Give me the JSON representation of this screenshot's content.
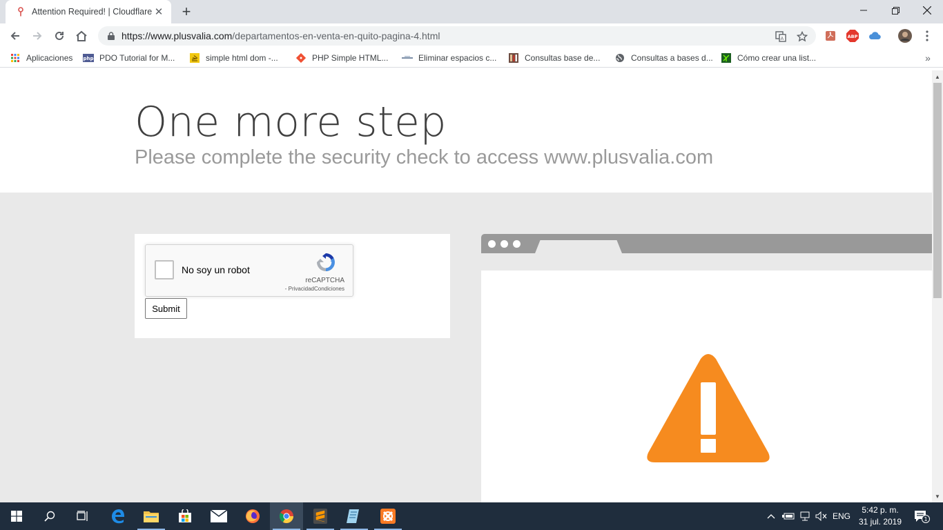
{
  "browser": {
    "tab_title": "Attention Required! | Cloudflare",
    "url_host": "https://www.plusvalia.com",
    "url_path": "/departamentos-en-venta-en-quito-pagina-4.html"
  },
  "bookmarks": [
    {
      "label": "Aplicaciones",
      "icon": "apps-grid-icon"
    },
    {
      "label": "PDO Tutorial for M...",
      "icon": "php-icon"
    },
    {
      "label": "simple html dom -...",
      "icon": "stackoverflow-icon"
    },
    {
      "label": "PHP Simple HTML...",
      "icon": "git-icon"
    },
    {
      "label": "Eliminar espacios c...",
      "icon": "site-icon"
    },
    {
      "label": "Consultas base de...",
      "icon": "books-icon"
    },
    {
      "label": "Consultas a bases d...",
      "icon": "globe-icon"
    },
    {
      "label": "Cómo crear una list...",
      "icon": "network-icon"
    }
  ],
  "page": {
    "title": "One more step",
    "subtitle": "Please complete the security check to access www.plusvalia.com",
    "captcha": {
      "label": "No soy un robot",
      "brand": "reCAPTCHA",
      "legal": "- PrivacidadCondiciones",
      "checked": false
    },
    "submit_label": "Submit"
  },
  "taskbar": {
    "language": "ENG",
    "time": "5:42 p. m.",
    "date": "31 jul. 2019",
    "notification_count": "1"
  },
  "colors": {
    "warning_orange": "#f68b1f",
    "taskbar_bg": "#1f2d3d",
    "page_bg": "#e9e9e9"
  }
}
